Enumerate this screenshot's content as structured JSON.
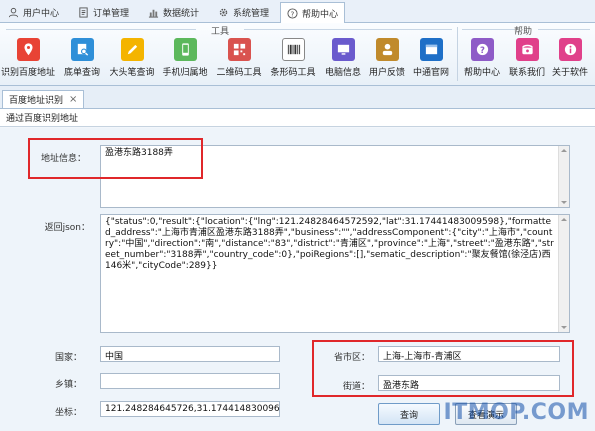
{
  "menu_tabs": [
    {
      "label": "用户中心",
      "icon": "user-icon"
    },
    {
      "label": "订单管理",
      "icon": "document-icon"
    },
    {
      "label": "数据统计",
      "icon": "bar-chart-icon"
    },
    {
      "label": "系统管理",
      "icon": "gear-icon"
    },
    {
      "label": "帮助中心",
      "icon": "help-icon",
      "active": true
    }
  ],
  "ribbon": {
    "group_tools_label": "工具",
    "group_help_label": "帮助",
    "tools": [
      {
        "label": "识别百度地址",
        "icon": "map-pin-icon",
        "color": "#e84335"
      },
      {
        "label": "底单查询",
        "icon": "receipt-search-icon",
        "color": "#2f8fd8"
      },
      {
        "label": "大头笔查询",
        "icon": "pen-icon",
        "color": "#f4b400"
      },
      {
        "label": "手机归属地",
        "icon": "mobile-icon",
        "color": "#5cb85c"
      },
      {
        "label": "二维码工具",
        "icon": "qrcode-icon",
        "color": "#d9534f"
      },
      {
        "label": "条形码工具",
        "icon": "barcode-icon",
        "color": "#444444"
      },
      {
        "label": "电脑信息",
        "icon": "monitor-icon",
        "color": "#6a5acd"
      },
      {
        "label": "用户反馈",
        "icon": "feedback-user-icon",
        "color": "#c08a2c"
      },
      {
        "label": "中通官网",
        "icon": "website-icon",
        "color": "#1e6fc7"
      }
    ],
    "help": [
      {
        "label": "帮助中心",
        "icon": "question-icon",
        "color": "#8e5bc7"
      },
      {
        "label": "联系我们",
        "icon": "phone-icon",
        "color": "#e0408a"
      },
      {
        "label": "关于软件",
        "icon": "info-icon",
        "color": "#e0408a"
      }
    ]
  },
  "doc_tab": {
    "label": "百度地址识别",
    "close": "×"
  },
  "page_header": "通过百度识别地址",
  "form": {
    "address_label": "地址信息：",
    "address_value": "盈港东路3188弄",
    "json_label": "返回json：",
    "json_value": "{\"status\":0,\"result\":{\"location\":{\"lng\":121.24828464572592,\"lat\":31.17441483009598},\"formatted_address\":\"上海市青浦区盈港东路3188弄\",\"business\":\"\",\"addressComponent\":{\"city\":\"上海市\",\"country\":\"中国\",\"direction\":\"南\",\"distance\":\"83\",\"district\":\"青浦区\",\"province\":\"上海\",\"street\":\"盈港东路\",\"street_number\":\"3188弄\",\"country_code\":0},\"poiRegions\":[],\"sematic_description\":\"聚友餐馆(徐泾店)西146米\",\"cityCode\":289}}",
    "country_label": "国家：",
    "country_value": "中国",
    "town_label": "乡镇：",
    "town_value": "",
    "coord_label": "坐标：",
    "coord_value": "121.248284645726,31.174414830096",
    "region_label": "省市区：",
    "region_value": "上海-上海市-青浦区",
    "street_label": "街道：",
    "street_value": "盈港东路",
    "query_button": "查询",
    "demo_button": "查看演示"
  },
  "watermark": "ITMOP.COM",
  "colors": {
    "highlight": "#e0272a",
    "accent": "#2f6fb6"
  }
}
